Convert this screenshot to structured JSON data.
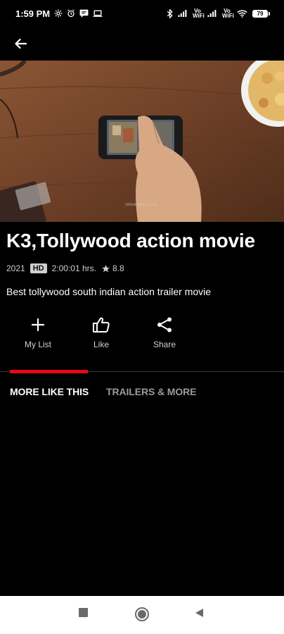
{
  "status_bar": {
    "time": "1:59 PM",
    "battery": "79",
    "net1": "Vo WiFi",
    "net2": "Vo WiFi"
  },
  "header": {
    "back_icon": "back-arrow-icon"
  },
  "movie": {
    "title": "K3,Tollywood action movie",
    "year": "2021",
    "quality": "HD",
    "duration": "2:00:01 hrs.",
    "rating": "8.8",
    "description": "Best tollywood south indian action trailer movie"
  },
  "actions": [
    {
      "label": "My List",
      "icon": "plus-icon"
    },
    {
      "label": "Like",
      "icon": "thumbs-up-icon"
    },
    {
      "label": "Share",
      "icon": "share-icon"
    }
  ],
  "tabs": [
    {
      "label": "MORE LIKE THIS",
      "active": true
    },
    {
      "label": "TRAILERS & MORE",
      "active": false
    }
  ],
  "colors": {
    "accent": "#e50914",
    "background": "#000000",
    "inactive_tab": "#9a9a9a"
  }
}
